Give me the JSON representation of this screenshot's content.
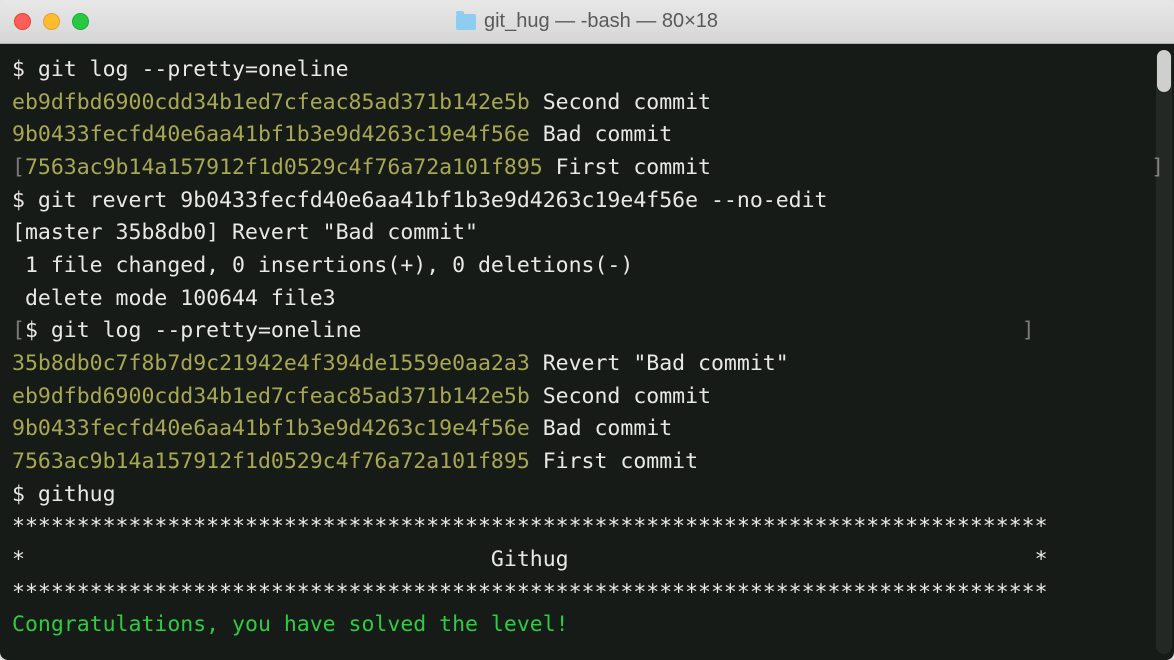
{
  "window": {
    "title": "git_hug — -bash — 80×18"
  },
  "prompts": {
    "p1": "$ git log --pretty=oneline",
    "p2": "$ git revert 9b0433fecfd40e6aa41bf1b3e9d4263c19e4f56e --no-edit",
    "p3": "$ git log --pretty=oneline",
    "p4": "$ githug"
  },
  "log1": [
    {
      "hash": "eb9dfbd6900cdd34b1ed7cfeac85ad371b142e5b",
      "msg": " Second commit"
    },
    {
      "hash": "9b0433fecfd40e6aa41bf1b3e9d4263c19e4f56e",
      "msg": " Bad commit"
    },
    {
      "hash": "7563ac9b14a157912f1d0529c4f76a72a101f895",
      "msg": " First commit"
    }
  ],
  "revert": {
    "line1": "[master 35b8db0] Revert \"Bad commit\"",
    "line2": " 1 file changed, 0 insertions(+), 0 deletions(-)",
    "line3": " delete mode 100644 file3"
  },
  "log2": [
    {
      "hash": "35b8db0c7f8b7d9c21942e4f394de1559e0aa2a3",
      "msg": " Revert \"Bad commit\""
    },
    {
      "hash": "eb9dfbd6900cdd34b1ed7cfeac85ad371b142e5b",
      "msg": " Second commit"
    },
    {
      "hash": "9b0433fecfd40e6aa41bf1b3e9d4263c19e4f56e",
      "msg": " Bad commit"
    },
    {
      "hash": "7563ac9b14a157912f1d0529c4f76a72a101f895",
      "msg": " First commit"
    }
  ],
  "banner": {
    "stars": "********************************************************************************",
    "mid": "*                                    Githug                                    *"
  },
  "congrats": "Congratulations, you have solved the level!",
  "brackets": {
    "open": "[",
    "close_pad": "                                  ]",
    "close_pad2": "                                                   ]"
  }
}
